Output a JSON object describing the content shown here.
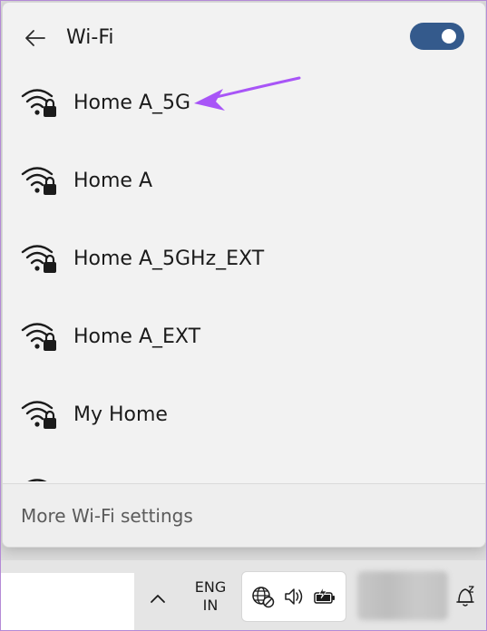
{
  "panel": {
    "title": "Wi-Fi",
    "toggle_state": "on",
    "footer_label": "More Wi-Fi settings"
  },
  "networks": [
    {
      "name": "Home A_5G",
      "icon": "wifi-secured-icon"
    },
    {
      "name": "Home A",
      "icon": "wifi-secured-icon"
    },
    {
      "name": "Home A_5GHz_EXT",
      "icon": "wifi-secured-icon"
    },
    {
      "name": "Home A_EXT",
      "icon": "wifi-secured-icon"
    },
    {
      "name": "My Home",
      "icon": "wifi-secured-icon"
    },
    {
      "name": "",
      "icon": "wifi-secured-icon"
    }
  ],
  "taskbar": {
    "lang_primary": "ENG",
    "lang_secondary": "IN"
  },
  "colors": {
    "accent": "#345a8c",
    "annotation": "#a855f7",
    "frame": "#b48ad6"
  }
}
